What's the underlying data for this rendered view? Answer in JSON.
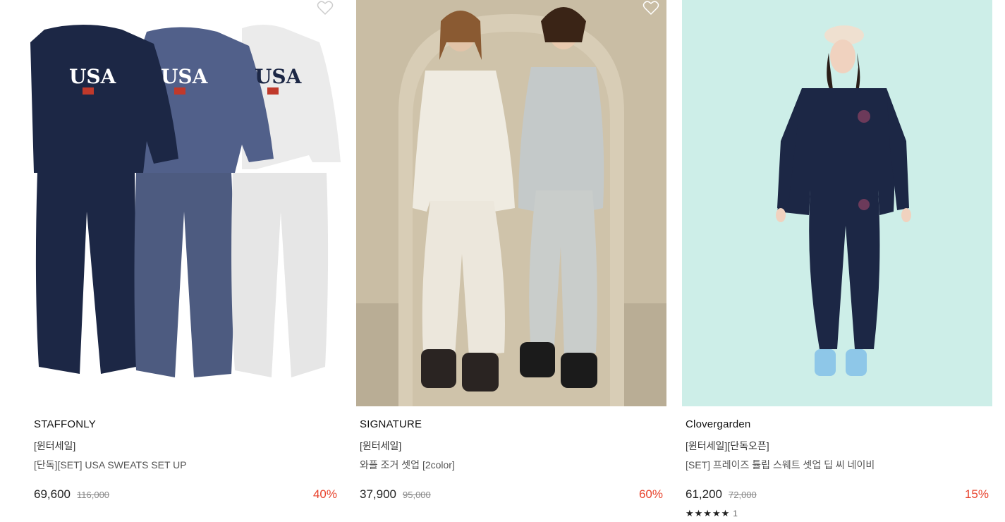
{
  "products": [
    {
      "brand": "STAFFONLY",
      "tag": "[윈터세일]",
      "name": "[단독][SET] USA SWEATS SET UP",
      "price": "69,600",
      "original_price": "116,000",
      "discount": "40%",
      "image_text": [
        "USA",
        "USA",
        "USA"
      ]
    },
    {
      "brand": "SIGNATURE",
      "tag": "[윈터세일]",
      "name": "와플 조거 셋업 [2color]",
      "price": "37,900",
      "original_price": "95,000",
      "discount": "60%"
    },
    {
      "brand": "Clovergarden",
      "tag": "[윈터세일][단독오픈]",
      "name": "[SET] 프레이즈 튤립 스웨트 셋업 딥 씨 네이비",
      "price": "61,200",
      "original_price": "72,000",
      "discount": "15%",
      "rating_stars": "★★★★★",
      "review_count": "1"
    }
  ],
  "colors": {
    "discount": "#e8442e",
    "navy": "#1c2745",
    "denim": "#4d5b80",
    "gray": "#e6e6e6",
    "mint": "#cdeee8",
    "wall": "#c9bda4"
  },
  "icons": {
    "wishlist": "heart-outline-icon"
  }
}
